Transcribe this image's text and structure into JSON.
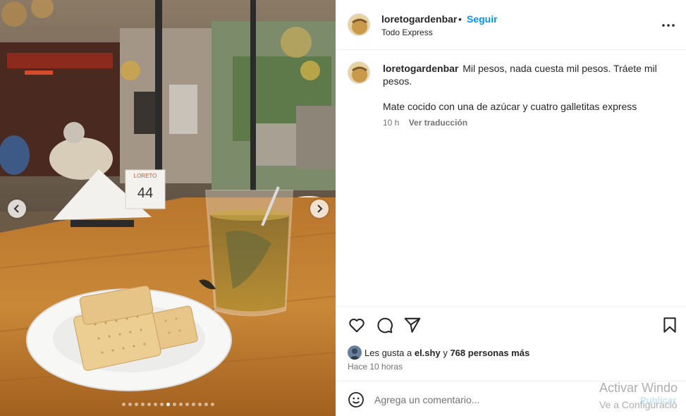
{
  "post": {
    "username": "loretogardenbar",
    "follow_label": "Seguir",
    "location": "Todo Express",
    "caption_username": "loretogardenbar",
    "caption_text": "Mil pesos, nada cuesta mil pesos. Tráete mil pesos.",
    "caption_text_2": "Mate cocido con una de azúcar y cuatro galletitas express",
    "age": "10 h",
    "translate_label": "Ver traducción",
    "likes_prefix": "Les gusta a",
    "likes_user": "el.shy",
    "likes_connector": "y",
    "likes_others": "768 personas más",
    "posted_time": "Hace 10 horas"
  },
  "comment": {
    "placeholder": "Agrega un comentario...",
    "publish_label": "Publicar"
  },
  "photo": {
    "table_number_top": "LORETO",
    "table_number": "44",
    "carousel_count": 15,
    "carousel_active": 7
  },
  "watermark": {
    "line1": "Activar Windo",
    "line2": "Ve a Configuració"
  },
  "icons": {
    "like": "heart-icon",
    "comment": "comment-icon",
    "share": "send-icon",
    "save": "bookmark-icon",
    "more": "more-horizontal-icon",
    "emoji": "smiley-icon",
    "prev": "chevron-left-icon",
    "next": "chevron-right-icon"
  },
  "colors": {
    "accent": "#0095f6",
    "text": "#262626",
    "muted": "#737373",
    "divider": "#efefef"
  }
}
